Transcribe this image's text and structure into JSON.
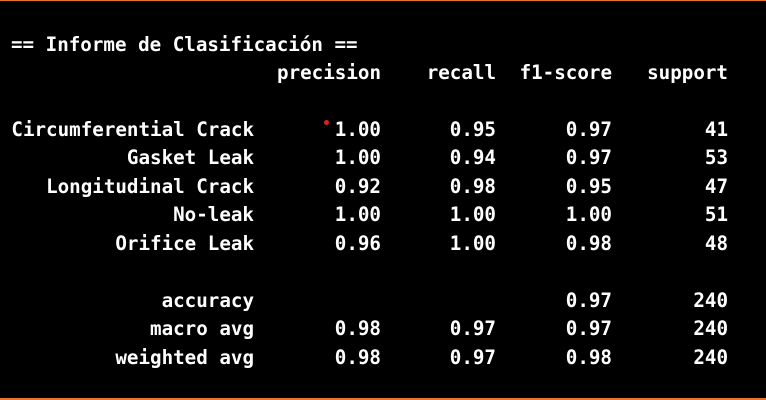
{
  "report": {
    "title": "== Informe de Clasificación ==",
    "headers": {
      "precision": "precision",
      "recall": "recall",
      "f1": "f1-score",
      "support": "support"
    },
    "rows": [
      {
        "label": "Circumferential Crack",
        "precision": "1.00",
        "recall": "0.95",
        "f1": "0.97",
        "support": "41"
      },
      {
        "label": "Gasket Leak",
        "precision": "1.00",
        "recall": "0.94",
        "f1": "0.97",
        "support": "53"
      },
      {
        "label": "Longitudinal Crack",
        "precision": "0.92",
        "recall": "0.98",
        "f1": "0.95",
        "support": "47"
      },
      {
        "label": "No-leak",
        "precision": "1.00",
        "recall": "1.00",
        "f1": "1.00",
        "support": "51"
      },
      {
        "label": "Orifice Leak",
        "precision": "0.96",
        "recall": "1.00",
        "f1": "0.98",
        "support": "48"
      }
    ],
    "summary": [
      {
        "label": "accuracy",
        "precision": "",
        "recall": "",
        "f1": "0.97",
        "support": "240"
      },
      {
        "label": "macro avg",
        "precision": "0.98",
        "recall": "0.97",
        "f1": "0.97",
        "support": "240"
      },
      {
        "label": "weighted avg",
        "precision": "0.98",
        "recall": "0.97",
        "f1": "0.98",
        "support": "240"
      }
    ]
  },
  "colors": {
    "background": "#000000",
    "text": "#ffffff",
    "border": "#e8742a",
    "cursor_dot": "#e02020"
  }
}
